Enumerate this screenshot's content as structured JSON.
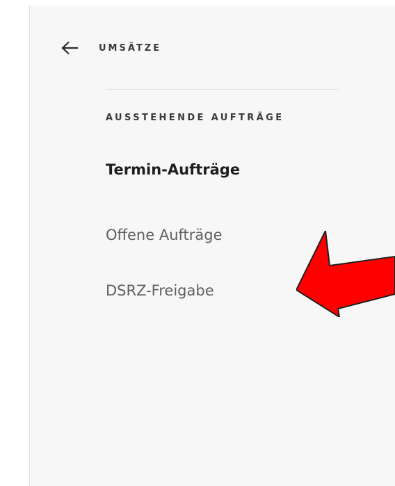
{
  "nav": {
    "back_label": "UMSÄTZE",
    "section_title": "AUSSTEHENDE AUFTRÄGE",
    "items": [
      {
        "label": "Termin-Aufträge",
        "active": true
      },
      {
        "label": "Offene Aufträge",
        "active": false
      },
      {
        "label": "DSRZ-Freigabe",
        "active": false
      }
    ]
  },
  "icons": {
    "back": "arrow-left-icon",
    "annotation": "red-arrow-pointer"
  },
  "colors": {
    "panel_background": "#f7f7f7",
    "active_text": "#1e1e1e",
    "inactive_text": "#606060",
    "annotation_red": "#ff0000"
  }
}
